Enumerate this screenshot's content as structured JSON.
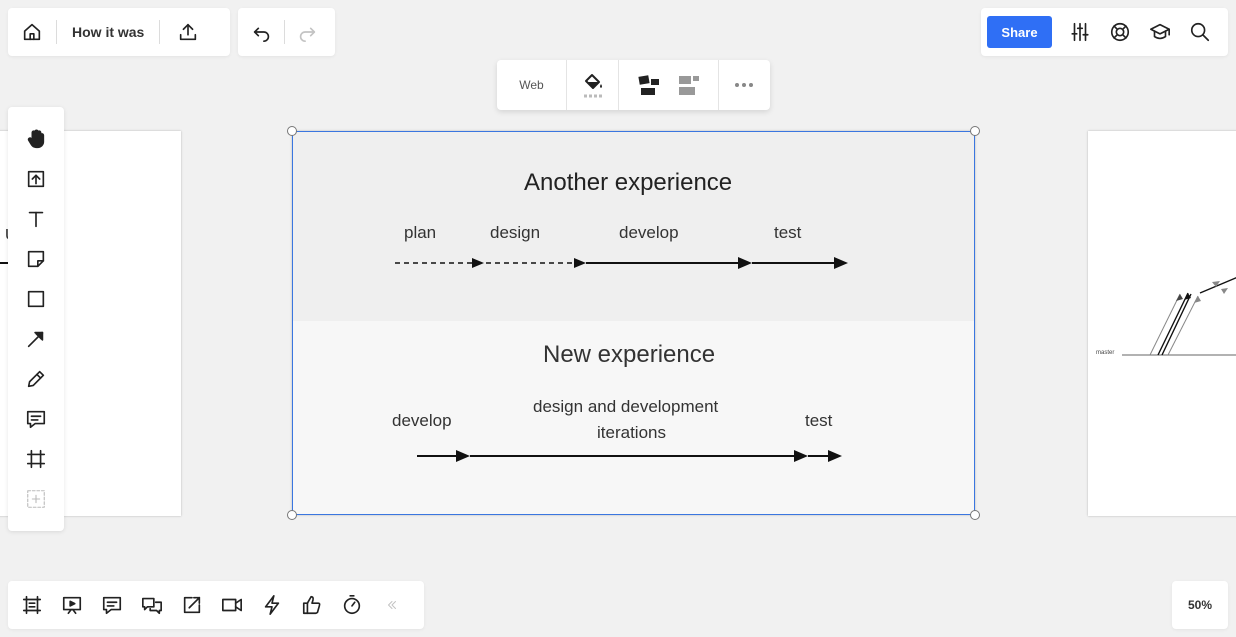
{
  "header": {
    "board_title": "How it was",
    "share_label": "Share"
  },
  "context_toolbar": {
    "font_label": "Web"
  },
  "canvas": {
    "left_frame_text": "p           ue",
    "right_frame_label": "master",
    "main_frame": {
      "section1_title": "Another experience",
      "section1_phases": [
        "plan",
        "design",
        "develop",
        "test"
      ],
      "section2_title": "New experience",
      "section2_phase_develop": "develop",
      "section2_phase_design_line1": "design and development",
      "section2_phase_design_line2": "iterations",
      "section2_phase_test": "test"
    }
  },
  "zoom": {
    "level": "50%"
  },
  "icons": {
    "top_left": [
      "home-icon",
      "export-icon"
    ],
    "history": [
      "undo-icon",
      "redo-icon"
    ],
    "top_right": [
      "settings-sliders-icon",
      "help-lifebuoy-icon",
      "learning-cap-icon",
      "search-icon"
    ],
    "left_toolbar": [
      "hand-icon",
      "upload-icon",
      "text-icon",
      "sticky-note-icon",
      "rectangle-icon",
      "arrow-icon",
      "pen-icon",
      "comment-icon",
      "frame-icon",
      "add-more-icon"
    ],
    "bottom_toolbar": [
      "frames-icon",
      "presentation-icon",
      "notes-icon",
      "chat-icon",
      "share-screen-icon",
      "video-icon",
      "lightning-icon",
      "thumbs-up-icon",
      "timer-icon",
      "collapse-icon"
    ]
  }
}
